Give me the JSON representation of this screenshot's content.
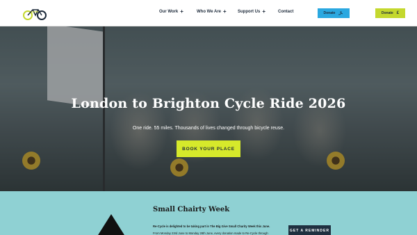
{
  "header": {
    "logo_text": "re-cycle",
    "nav": [
      {
        "label": "Our Work",
        "has_submenu": true
      },
      {
        "label": "Who We Are",
        "has_submenu": true
      },
      {
        "label": "Support Us",
        "has_submenu": true
      },
      {
        "label": "Contact",
        "has_submenu": false
      }
    ],
    "donate_buttons": [
      {
        "label": "Donate",
        "icon": "hand-heart-icon",
        "color": "#2aa8e0"
      },
      {
        "label": "Donate",
        "icon": "pound-sign-icon",
        "icon_glyph": "£",
        "color": "#c4d82e"
      }
    ]
  },
  "hero": {
    "title": "London to Brighton Cycle Ride 2026",
    "subtitle": "One ride. 55 miles. Thousands of lives changed through bicycle reuse.",
    "cta_label": "BOOK YOUR PLACE",
    "cta_color": "#d6e92b"
  },
  "section": {
    "title": "Small Chairty Week",
    "intro": "Re-Cycle is delighted to be taking part in The Big Give Small Charity Week this June.",
    "body": "From Monday 23rd June to Monday 28th June, every donation made to Re-Cycle through",
    "reminder_label": "GET A REMINDER",
    "background_color": "#8fd1d3"
  }
}
